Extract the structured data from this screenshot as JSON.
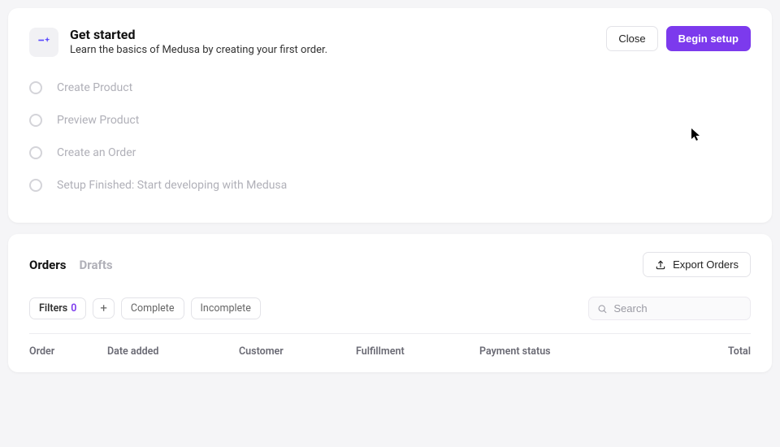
{
  "getStarted": {
    "title": "Get started",
    "subtitle": "Learn the basics of Medusa by creating your first order.",
    "close_label": "Close",
    "begin_label": "Begin setup",
    "steps": [
      {
        "label": "Create Product"
      },
      {
        "label": "Preview Product"
      },
      {
        "label": "Create an Order"
      },
      {
        "label": "Setup Finished: Start developing with Medusa"
      }
    ]
  },
  "orders": {
    "tabs": {
      "orders": "Orders",
      "drafts": "Drafts"
    },
    "export_label": "Export Orders",
    "filters": {
      "label": "Filters",
      "count": "0",
      "complete": "Complete",
      "incomplete": "Incomplete"
    },
    "search_placeholder": "Search",
    "columns": {
      "order": "Order",
      "date": "Date added",
      "customer": "Customer",
      "fulfillment": "Fulfillment",
      "payment": "Payment status",
      "total": "Total"
    }
  }
}
